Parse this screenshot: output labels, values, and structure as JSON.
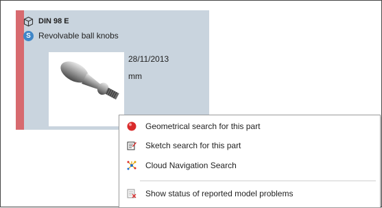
{
  "part": {
    "standard": "DIN 98 E",
    "name": "Revolvable ball knobs",
    "date": "28/11/2013",
    "unit": "mm",
    "badge_letter": "S",
    "accent_color": "#d76a6f",
    "card_color": "#c9d4de"
  },
  "context_menu": {
    "items": [
      {
        "label": "Geometrical search for this part",
        "icon": "red-sphere-icon"
      },
      {
        "label": "Sketch search for this part",
        "icon": "sketch-icon"
      },
      {
        "label": "Cloud Navigation Search",
        "icon": "cloud-navigation-icon"
      },
      {
        "label": "Show status of reported model problems",
        "icon": "report-status-icon"
      }
    ]
  }
}
